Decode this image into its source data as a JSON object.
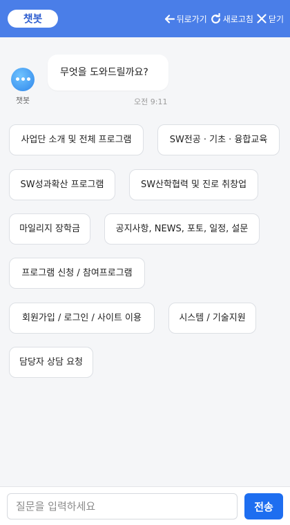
{
  "header": {
    "logo": "챗봇",
    "back_label": "뒤로가기",
    "refresh_label": "새로고침",
    "close_label": "닫기",
    "icons": {
      "back": "arrow-left-icon",
      "refresh": "refresh-icon",
      "close": "close-icon"
    },
    "background": "#4a7ee8"
  },
  "bot": {
    "name": "챗봇",
    "avatar_icon": "chat-bubble-icon"
  },
  "message": {
    "text": "무엇을 도와드릴까요?",
    "time": "오전 9:11"
  },
  "quick_replies": [
    "사업단 소개 및 전체 프로그램",
    "SW전공 · 기초 · 융합교육",
    "SW성과확산 프로그램",
    "SW산학협력 및 진로 취창업",
    "마일리지 장학금",
    "공지사항, NEWS, 포토, 일정, 설문",
    "프로그램 신청 / 참여프로그램",
    "회원가입 / 로그인 / 사이트 이용",
    "시스템 / 기술지원",
    "담당자 상담 요청"
  ],
  "input": {
    "placeholder": "질문을 입력하세요",
    "value": ""
  },
  "send_label": "전송",
  "colors": {
    "accent": "#1e6ef0",
    "page_background": "#f5f6f8"
  }
}
